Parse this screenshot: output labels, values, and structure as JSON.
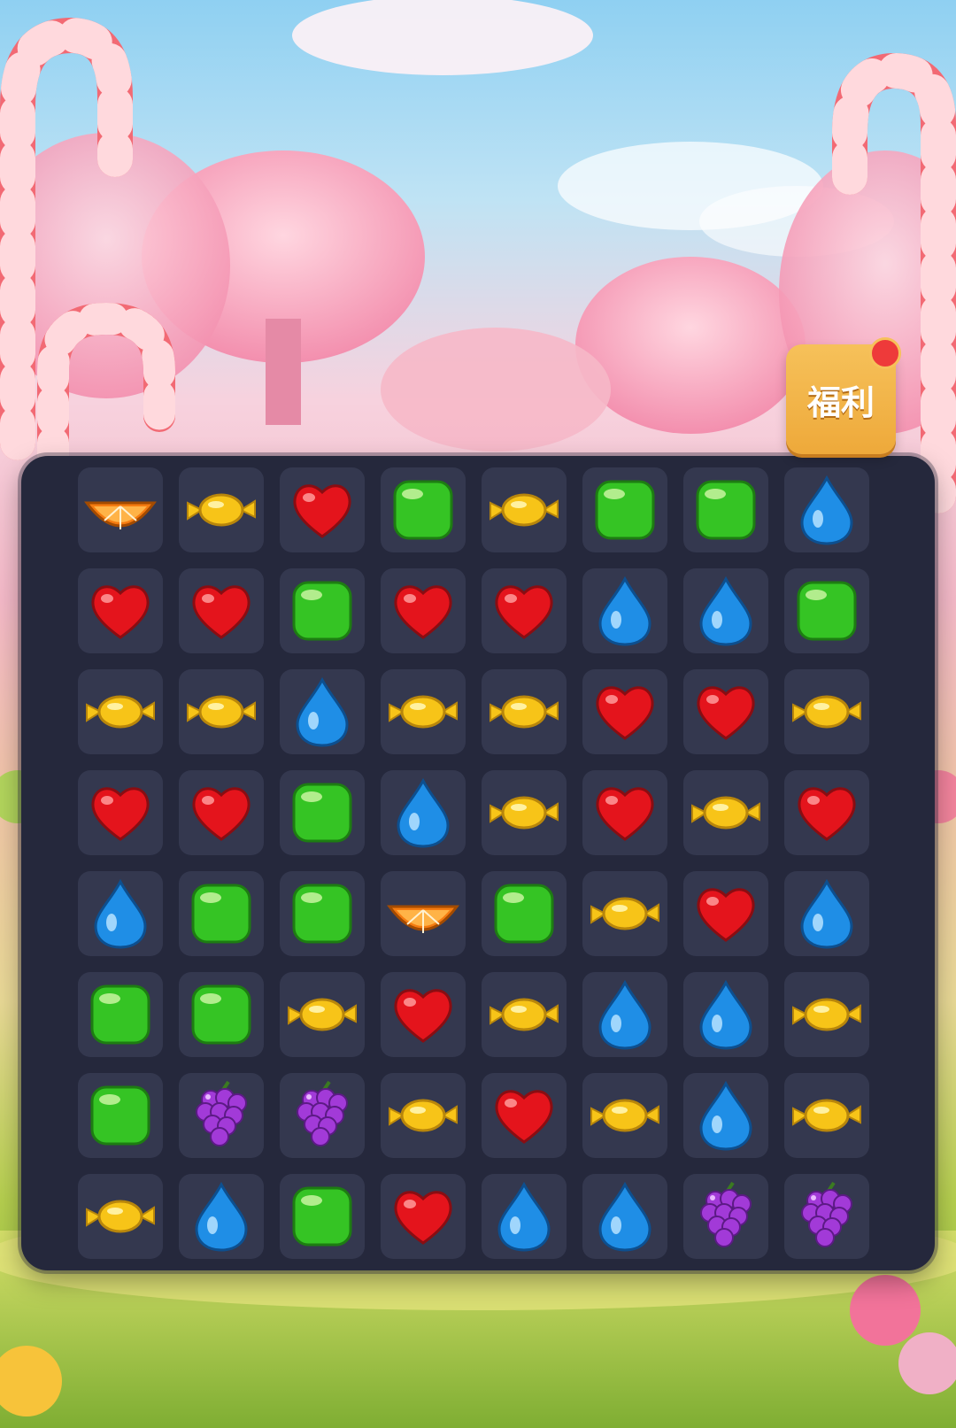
{
  "welfare_button": {
    "label": "福利",
    "badge_color": "#ee3a3a"
  },
  "board": {
    "rows": 8,
    "cols": 8,
    "grid": [
      [
        "orange",
        "candy",
        "heart",
        "jelly",
        "candy",
        "jelly",
        "jelly",
        "drop"
      ],
      [
        "heart",
        "heart",
        "jelly",
        "heart",
        "heart",
        "drop",
        "drop",
        "jelly"
      ],
      [
        "candy",
        "candy",
        "drop",
        "candy",
        "candy",
        "heart",
        "heart",
        "candy"
      ],
      [
        "heart",
        "heart",
        "jelly",
        "drop",
        "candy",
        "heart",
        "candy",
        "heart"
      ],
      [
        "drop",
        "jelly",
        "jelly",
        "orange",
        "jelly",
        "candy",
        "heart",
        "drop"
      ],
      [
        "jelly",
        "jelly",
        "candy",
        "heart",
        "candy",
        "drop",
        "drop",
        "candy"
      ],
      [
        "jelly",
        "grape",
        "grape",
        "candy",
        "heart",
        "candy",
        "drop",
        "candy"
      ],
      [
        "candy",
        "drop",
        "jelly",
        "heart",
        "drop",
        "drop",
        "grape",
        "grape"
      ]
    ]
  },
  "piece_icons": {
    "heart": "red-heart-icon",
    "jelly": "green-jelly-icon",
    "candy": "yellow-wrapped-candy-icon",
    "drop": "blue-drop-icon",
    "orange": "orange-slice-icon",
    "grape": "purple-grape-icon"
  },
  "colors": {
    "board_bg": "#25283c",
    "cell_bg": "#34384f",
    "heart": "#e4141c",
    "jelly": "#35c424",
    "candy": "#f7c418",
    "drop": "#1f8ee6",
    "orange": "#f57b10",
    "grape": "#a23ad8",
    "button": "#f2b347"
  }
}
